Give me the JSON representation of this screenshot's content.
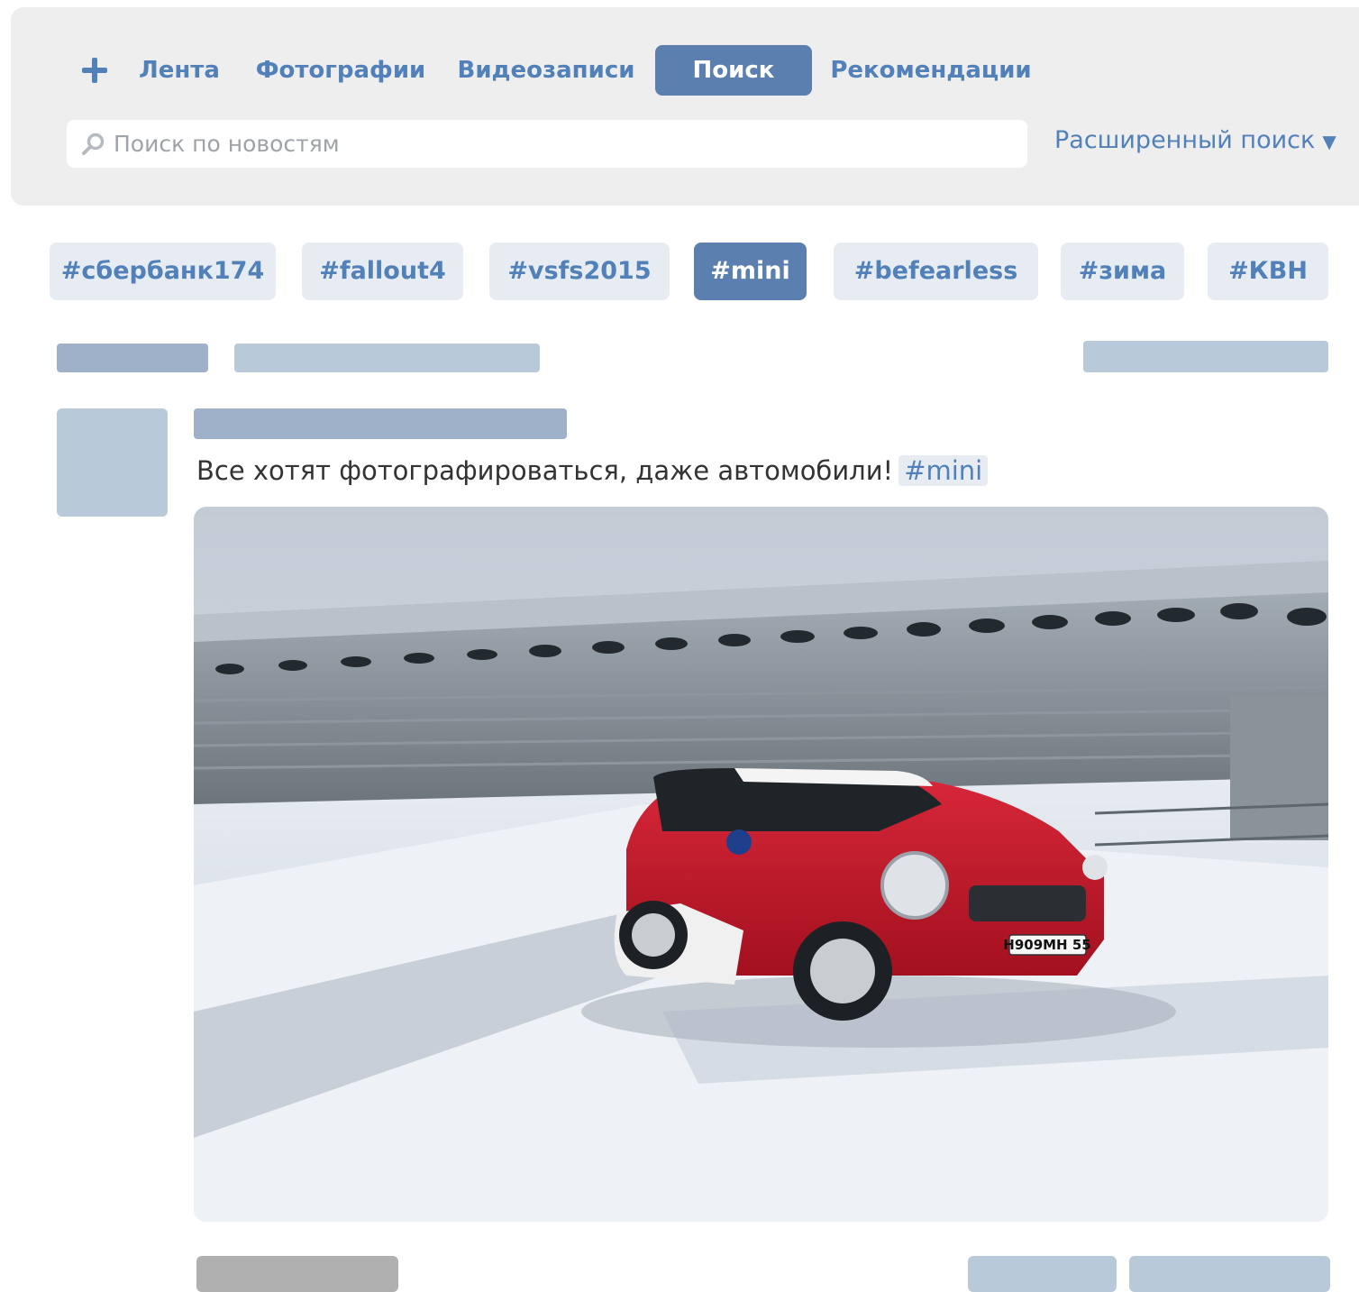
{
  "nav": {
    "add_label": "+",
    "tabs": [
      {
        "label": "Лента"
      },
      {
        "label": "Фотографии"
      },
      {
        "label": "Видеозаписи"
      },
      {
        "label": "Поиск"
      },
      {
        "label": "Рекомендации"
      }
    ],
    "active_tab": "Поиск"
  },
  "search": {
    "placeholder": "Поиск по новостям",
    "value": "",
    "advanced_label": "Расширенный поиск",
    "advanced_arrow": "▼"
  },
  "hashtags": [
    "#сбербанк174",
    "#fallout4",
    "#vsfs2015",
    "#mini",
    "#befearless",
    "#зима",
    "#КВН"
  ],
  "active_hashtag": "#mini",
  "post": {
    "text": "Все хотят фотографироваться, даже автомобили!",
    "hashtag": "#mini",
    "plate": "Н909МН 55"
  },
  "colors": {
    "accent": "#5181b8",
    "active_bg": "#5b7fae",
    "tag_bg": "#e7ecf2",
    "placeholder_dark": "#9eb1c8",
    "placeholder_light": "#b8c9d9"
  }
}
